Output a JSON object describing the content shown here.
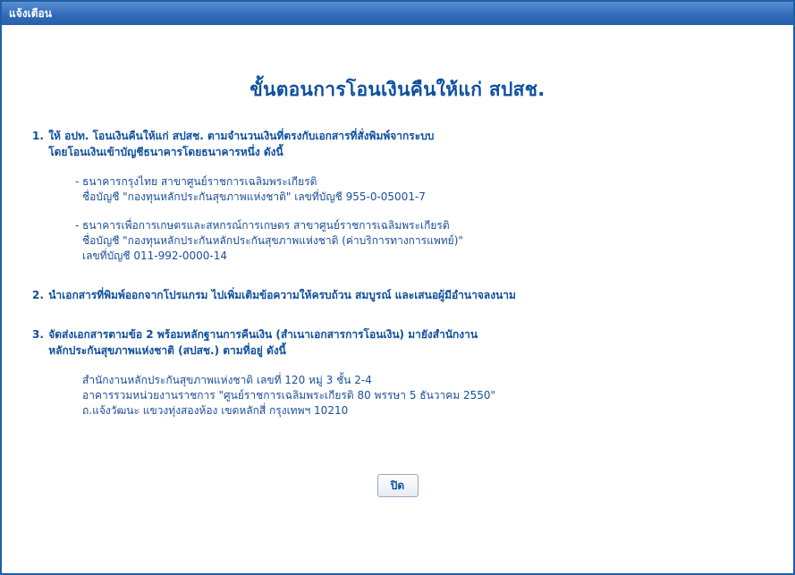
{
  "window": {
    "title": "แจ้งเตือน"
  },
  "heading": "ขั้นตอนการโอนเงินคืนให้แก่ สปสช.",
  "steps": [
    {
      "number": "1.",
      "text_line1": "ให้ อปท. โอนเงินคืนให้แก่ สปสช. ตามจำนวนเงินที่ตรงกับเอกสารที่สั่งพิมพ์จากระบบ",
      "text_line2": "โดยโอนเงินเข้าบัญชีธนาคารโดยธนาคารหนึ่ง ดังนี้"
    },
    {
      "number": "2.",
      "text_line1": "นำเอกสารที่พิมพ์ออกจากโปรแกรม ไปเพิ่มเติมข้อความให้ครบถ้วน สมบูรณ์ และเสนอผู้มีอำนาจลงนาม"
    },
    {
      "number": "3.",
      "text_line1": "จัดส่งเอกสารตามข้อ 2 พร้อมหลักฐานการคืนเงิน (สำเนาเอกสารการโอนเงิน) มายังสำนักงาน",
      "text_line2": "หลักประกันสุขภาพแห่งชาติ (สปสช.) ตามที่อยู่ ดังนี้"
    }
  ],
  "banks": [
    {
      "bullet": "-",
      "line1": "ธนาคารกรุงไทย สาขาศูนย์ราชการเฉลิมพระเกียรติ",
      "line2": "ชื่อบัญชี \"กองทุนหลักประกันสุขภาพแห่งชาติ\" เลขที่บัญชี 955-0-05001-7"
    },
    {
      "bullet": "-",
      "line1": "ธนาคารเพื่อการเกษตรและสหกรณ์การเกษตร สาขาศูนย์ราชการเฉลิมพระเกียรติ",
      "line2": "ชื่อบัญชี \"กองทุนหลักประกันหลักประกันสุขภาพแห่งชาติ (ค่าบริการทางการแพทย์)\"",
      "line3": "เลขที่บัญชี 011-992-0000-14"
    }
  ],
  "address": {
    "line1": "สำนักงานหลักประกันสุขภาพแห่งชาติ เลขที่ 120 หมู่ 3 ชั้น 2-4",
    "line2": "อาคารรวมหน่วยงานราชการ \"ศูนย์ราชการเฉลิมพระเกียรติ 80 พรรษา 5 ธันวาคม 2550\"",
    "line3": "ถ.แจ้งวัฒนะ แขวงทุ่งสองห้อง เขตหลักสี่ กรุงเทพฯ 10210"
  },
  "button": {
    "label": "ปิด"
  },
  "colors": {
    "title_bar": "#2f6ab8",
    "text": "#0e4f9f",
    "border": "#1f5fa8"
  }
}
